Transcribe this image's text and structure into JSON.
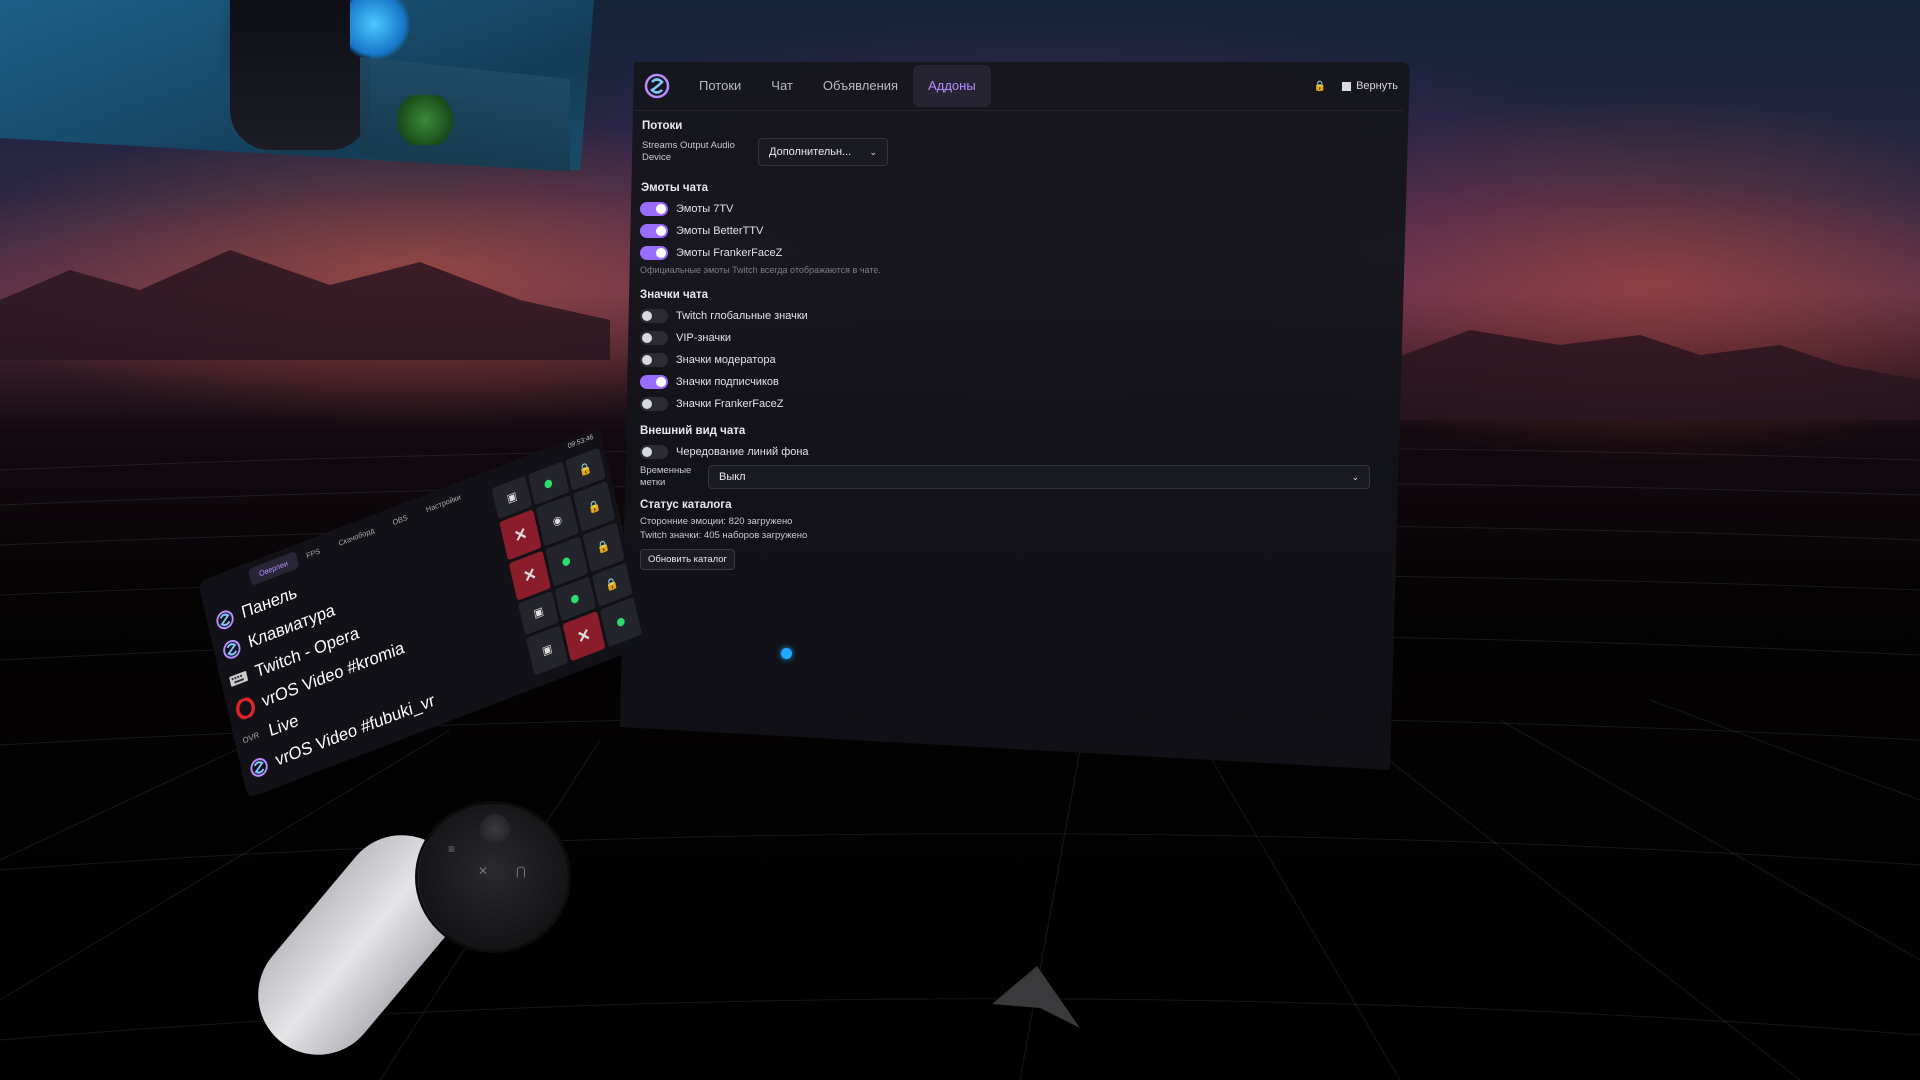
{
  "panel": {
    "tabs": [
      {
        "label": "Потоки",
        "active": false
      },
      {
        "label": "Чат",
        "active": false
      },
      {
        "label": "Объявления",
        "active": false
      },
      {
        "label": "Аддоны",
        "active": true
      }
    ],
    "revert_label": "Вернуть",
    "lock_icon": "lock-icon",
    "streams": {
      "heading": "Потоки",
      "audio_label": "Streams Output Audio Device",
      "audio_value": "Дополнительн..."
    },
    "emotes": {
      "heading": "Эмоты чата",
      "toggles": [
        {
          "label": "Эмоты 7TV",
          "on": true
        },
        {
          "label": "Эмоты BetterTTV",
          "on": true
        },
        {
          "label": "Эмоты FrankerFaceZ",
          "on": true
        }
      ],
      "note": "Официальные эмоты Twitch всегда отображаются в чате."
    },
    "badges": {
      "heading": "Значки чата",
      "toggles": [
        {
          "label": "Twitch глобальные значки",
          "on": false
        },
        {
          "label": "VIP-значки",
          "on": false
        },
        {
          "label": "Значки модератора",
          "on": false
        },
        {
          "label": "Значки подписчиков",
          "on": true
        },
        {
          "label": "Значки FrankerFaceZ",
          "on": false
        }
      ]
    },
    "appearance": {
      "heading": "Внешний вид чата",
      "alternate_label": "Чередование линий фона",
      "alternate_on": false,
      "timestamps_label": "Временные метки",
      "timestamps_value": "Выкл"
    },
    "catalog": {
      "heading": "Статус каталога",
      "line1": "Сторонние эмоции: 820 загружено",
      "line2": "Twitch значки: 405 наборов загружено",
      "refresh_label": "Обновить каталог"
    }
  },
  "side_menu": {
    "time": "09:53:46",
    "tabs": [
      "Оверлеи",
      "FPS",
      "Скачоборд",
      "OBS",
      "Настройки"
    ],
    "items": [
      {
        "label": "Панель",
        "icon": "app-logo-icon"
      },
      {
        "label": "Клавиатура",
        "icon": "app-logo-icon"
      },
      {
        "label": "Twitch - Opera",
        "icon": "keyboard-icon"
      },
      {
        "label": "vrOS Video #kromia",
        "icon": "opera-icon"
      },
      {
        "label": "Live",
        "icon": "ovr-icon"
      },
      {
        "label": "vrOS Video #fubuki_vr",
        "icon": "app-logo-icon"
      }
    ]
  },
  "colors": {
    "accent": "#9a6cff",
    "accent_text": "#b88cff",
    "cursor": "#21a9ff"
  }
}
